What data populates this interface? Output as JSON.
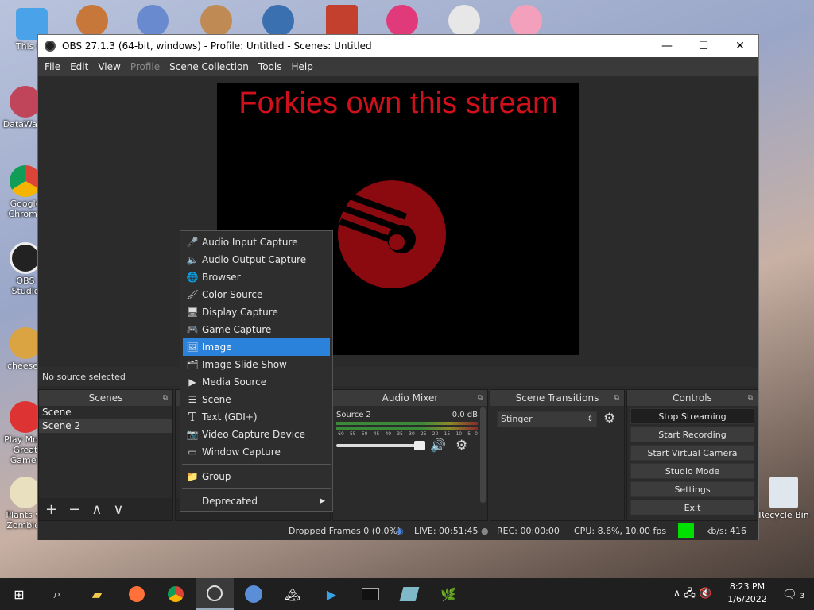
{
  "desktop": {
    "icons": [
      "This PC",
      "DataWave",
      "Google Chrome",
      "OBS Studio",
      "cheeseb",
      "Play More Great Games",
      "Plants vs Zombies"
    ],
    "recycle_bin": "Recycle Bin"
  },
  "window": {
    "title": "OBS 27.1.3 (64-bit, windows) - Profile: Untitled - Scenes: Untitled",
    "minimize": "—",
    "maximize": "☐",
    "close": "✕"
  },
  "menu": [
    "File",
    "Edit",
    "View",
    "Profile",
    "Scene Collection",
    "Tools",
    "Help"
  ],
  "preview": {
    "headline": "Forkies own this stream",
    "brand_color": "#8b0a0f"
  },
  "source_bar": "No source selected",
  "scenes": {
    "title": "Scenes",
    "items": [
      "Scene",
      "Scene 2"
    ],
    "selected_index": 1
  },
  "audio_mixer": {
    "title": "Audio Mixer",
    "source": "Source 2",
    "level": "0.0 dB",
    "ticks": [
      "-60",
      "-55",
      "-50",
      "-45",
      "-40",
      "-35",
      "-30",
      "-25",
      "-20",
      "-15",
      "-10",
      "-5",
      "0"
    ]
  },
  "transitions": {
    "title": "Scene Transitions",
    "selected": "Stinger"
  },
  "controls": {
    "title": "Controls",
    "buttons": [
      "Stop Streaming",
      "Start Recording",
      "Start Virtual Camera",
      "Studio Mode",
      "Settings",
      "Exit"
    ]
  },
  "status": {
    "dropped": "Dropped Frames 0 (0.0%)",
    "live": "LIVE: 00:51:45",
    "rec": "REC: 00:00:00",
    "cpu": "CPU: 8.6%, 10.00 fps",
    "kbs": "kb/s: 416",
    "health_color": "#00e000"
  },
  "context_menu": {
    "items": [
      "Audio Input Capture",
      "Audio Output Capture",
      "Browser",
      "Color Source",
      "Display Capture",
      "Game Capture",
      "Image",
      "Image Slide Show",
      "Media Source",
      "Scene",
      "Text (GDI+)",
      "Video Capture Device",
      "Window Capture"
    ],
    "highlighted_index": 6,
    "group": "Group",
    "deprecated": "Deprecated",
    "highlight_color": "#2a82da"
  },
  "taskbar": {
    "time": "8:23 PM",
    "date": "1/6/2022",
    "notifications": "3"
  }
}
